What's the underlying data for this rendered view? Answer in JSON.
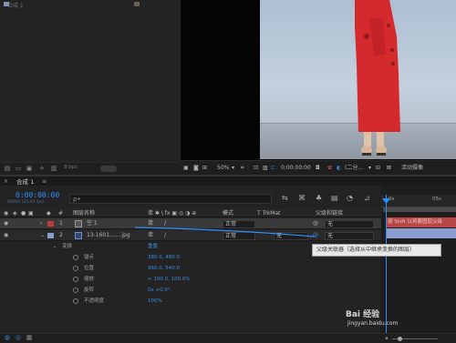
{
  "project": {
    "rows": [
      {
        "name": "合成 1",
        "type": ""
      }
    ],
    "depth_label": "8 bpc"
  },
  "viewer": {
    "zoom": "50%",
    "timecode": "0:00:00:00",
    "resolution": "(二分...",
    "camera": "活动摄像"
  },
  "timeline": {
    "tab_label": "合成 1",
    "tab_close": "≡",
    "timecode": "0:00:00:00",
    "timecode_sub": "00000 (25.00 fps)",
    "search_placeholder": "ρ•",
    "header": {
      "source_name": "图层名称",
      "switches": "单 ✱ \\ fx ▣ ◎ ◑ ⊕",
      "mode": "模式",
      "trkmat": "T TrkMat",
      "parent": "父级和链接"
    },
    "ruler_labels": [
      "0s",
      "05s"
    ],
    "layers": [
      {
        "index": "1",
        "name": "空 1",
        "color": "#c03a3a",
        "mode": "正常",
        "trkmat": "",
        "parent": "无"
      },
      {
        "index": "2",
        "name": "13-1601.......jpg",
        "color": "#8c9ccc",
        "mode": "正常",
        "trkmat": "无",
        "parent": "无"
      }
    ],
    "transform": {
      "label": "变换",
      "reset": "重置",
      "properties": [
        {
          "name": "锚点",
          "value": "380.0, 480.0"
        },
        {
          "name": "位置",
          "value": "960.0, 540.0"
        },
        {
          "name": "缩放",
          "value": "∞ 100.0, 100.0%"
        },
        {
          "name": "旋转",
          "value": "0x +0.0°"
        },
        {
          "name": "不透明度",
          "value": "100%"
        }
      ]
    },
    "track_hint": "按 Shift 以将要图层父级",
    "tooltip": "父级关联器（选择从中继承变换的图层）"
  },
  "watermark": {
    "text": "Bai 经验",
    "url": "jingyan.baidu.com"
  },
  "colors": {
    "accent": "#2f8fff",
    "layer1": "#c03a3a",
    "layer2": "#8c9ccc",
    "dress": "#d42a2e"
  }
}
